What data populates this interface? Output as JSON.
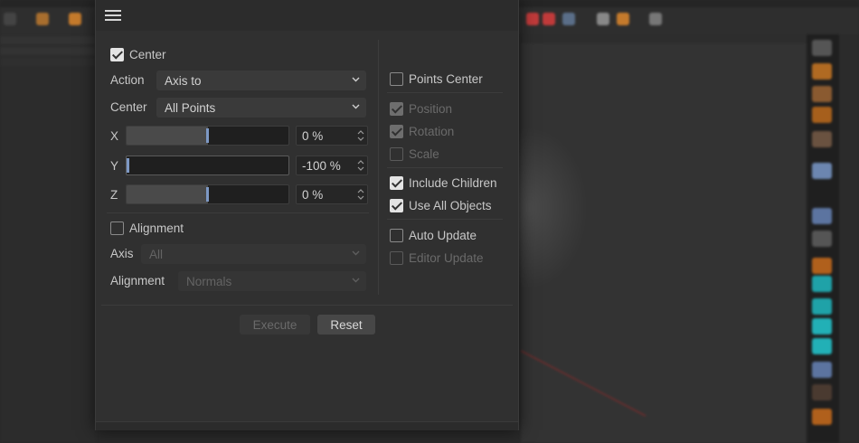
{
  "dialog": {
    "menu_icon": "hamburger-menu-icon",
    "center_checkbox": {
      "label": "Center",
      "checked": true
    },
    "action": {
      "label": "Action",
      "value": "Axis to"
    },
    "center_mode": {
      "label": "Center",
      "value": "All Points"
    },
    "x": {
      "label": "X",
      "value": "0 %",
      "fill": 0.5
    },
    "y": {
      "label": "Y",
      "value": "-100 %",
      "fill": 0.0
    },
    "z": {
      "label": "Z",
      "value": "0 %",
      "fill": 0.5
    },
    "alignment_checkbox": {
      "label": "Alignment",
      "checked": false
    },
    "axis": {
      "label": "Axis",
      "value": "All"
    },
    "alignment_mode": {
      "label": "Alignment",
      "value": "Normals"
    },
    "right_options": [
      {
        "label": "Points Center",
        "checked": false,
        "enabled": true
      },
      {
        "label": "Position",
        "checked": true,
        "enabled": false
      },
      {
        "label": "Rotation",
        "checked": true,
        "enabled": false
      },
      {
        "label": "Scale",
        "checked": false,
        "enabled": false
      },
      {
        "label": "Include Children",
        "checked": true,
        "enabled": true
      },
      {
        "label": "Use All Objects",
        "checked": true,
        "enabled": true
      },
      {
        "label": "Auto Update",
        "checked": false,
        "enabled": true
      },
      {
        "label": "Editor Update",
        "checked": false,
        "enabled": false
      }
    ],
    "buttons": {
      "execute": "Execute",
      "reset": "Reset"
    }
  },
  "colors": {
    "accent_handle": "#7d98c4",
    "dialog_bg": "#303030",
    "viewport_axis": "#8a2a2a"
  }
}
